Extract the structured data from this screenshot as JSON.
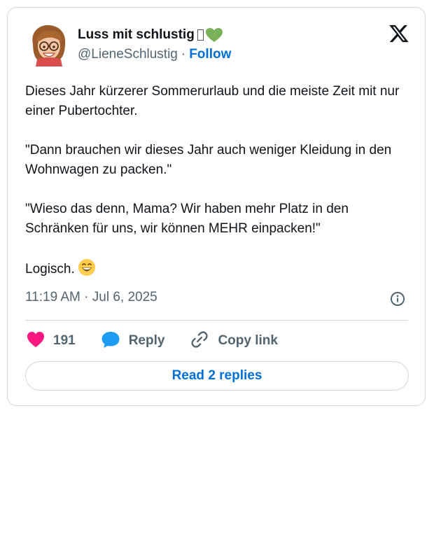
{
  "tweet": {
    "author": {
      "display_name": "Luss mit schlustig",
      "handle": "@LieneSchlustig",
      "follow_label": "Follow"
    },
    "separator": "·",
    "paragraphs": [
      "Dieses Jahr kürzerer Sommerurlaub und die meiste Zeit mit nur einer Pubertochter.",
      "\"Dann brauchen wir dieses Jahr auch weniger Kleidung in den Wohnwagen zu packen.\"",
      "\"Wieso das denn, Mama? Wir haben mehr Platz in den Schränken für uns, wir können MEHR einpacken!\""
    ],
    "closing": "Logisch.",
    "timestamp": "11:19 AM · Jul 6, 2025",
    "actions": {
      "likes_count": "191",
      "reply_label": "Reply",
      "copy_link_label": "Copy link"
    },
    "read_replies_label": "Read 2 replies"
  },
  "colors": {
    "accent": "#006fd6",
    "like": "#f91880",
    "reply_bubble": "#1d9bf0",
    "secondary_text": "#536471",
    "border": "#cfd9de"
  },
  "icons": [
    "avatar-memoji",
    "green-heart-emoji",
    "x-logo-icon",
    "info-icon",
    "heart-icon",
    "reply-bubble-icon",
    "link-icon",
    "grinning-emoji"
  ]
}
